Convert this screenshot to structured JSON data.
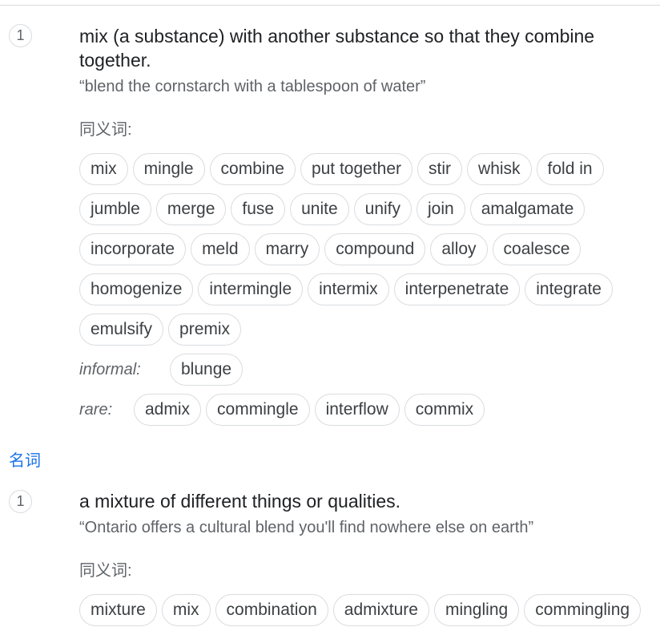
{
  "senses": [
    {
      "number": "1",
      "definition": "mix (a substance) with another substance so that they combine together.",
      "example": "“blend the cornstarch with a tablespoon of water”",
      "synonyms_label": "同义词:",
      "synonym_rows": [
        [
          "mix",
          "mingle",
          "combine",
          "put together",
          "stir",
          "whisk",
          "fold in"
        ],
        [
          "jumble",
          "merge",
          "fuse",
          "unite",
          "unify",
          "join",
          "amalgamate"
        ],
        [
          "incorporate",
          "meld",
          "marry",
          "compound",
          "alloy",
          "coalesce"
        ],
        [
          "homogenize",
          "intermingle",
          "intermix",
          "interpenetrate",
          "integrate"
        ],
        [
          "emulsify",
          "premix"
        ]
      ],
      "informal_label": "informal:",
      "informal_synonyms": [
        "blunge"
      ],
      "rare_label": "rare:",
      "rare_synonyms": [
        "admix",
        "commingle",
        "interflow",
        "commix"
      ]
    }
  ],
  "part_of_speech": "名词",
  "noun_senses": [
    {
      "number": "1",
      "definition": "a mixture of different things or qualities.",
      "example": "“Ontario offers a cultural blend you'll find nowhere else on earth”",
      "synonyms_label": "同义词:",
      "synonym_rows": [
        [
          "mixture",
          "mix",
          "combination",
          "admixture",
          "mingling",
          "commingling"
        ]
      ]
    }
  ]
}
